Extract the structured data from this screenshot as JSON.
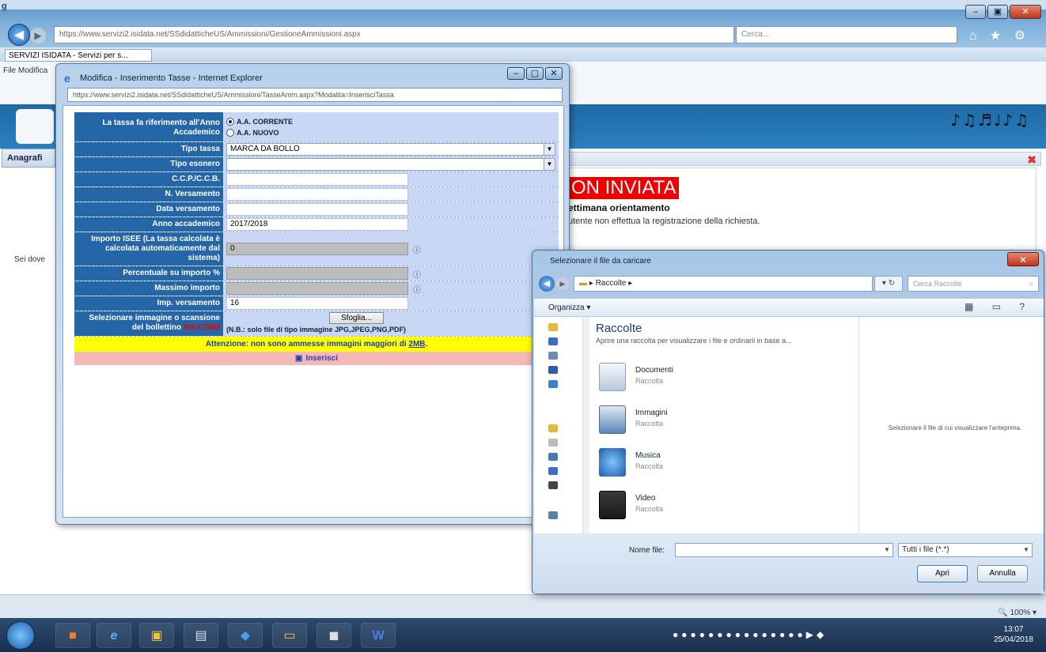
{
  "browser": {
    "top_strip_text": "g",
    "address": "https://www.servizi2.isidata.net/SSdidatticheUS/Ammissioni/GestioneAmmissioni.aspx",
    "search_placeholder": "Cerca...",
    "tab_label": "SERVIZI ISIDATA - Servizi per s...",
    "menu_text": "File  Modifica",
    "window_buttons": [
      "–",
      "▣",
      "✕"
    ],
    "toolbar_icons": "⌂ ★ ⚙"
  },
  "page": {
    "logo_right_text": "♪♫♬♩♪♫",
    "side_tab": "Anagrafi",
    "side_label": "Sei dove",
    "not_sent_banner": "ON INVIATA",
    "week_title": "ettimana orientamento",
    "week_text": "utente non effettua la registrazione della richiesta.",
    "zoom": "100%"
  },
  "popup": {
    "title": "Modifica - Inserimento Tasse - Internet Explorer",
    "address": "https://www.servizi2.isidata.net/SSdidatticheUS/Ammissioni/TasseAmm.aspx?Modalita=InserisciTassa",
    "form": {
      "row_anno": {
        "label": "La tassa fa riferimento all'Anno Accademico",
        "opt1": "A.A. CORRENTE",
        "opt2": "A.A. NUOVO"
      },
      "row_tipo_tassa": {
        "label": "Tipo tassa",
        "value": "MARCA DA BOLLO"
      },
      "row_tipo_esonero": {
        "label": "Tipo esonero",
        "value": ""
      },
      "row_ccp": {
        "label": "C.C.P./C.C.B.",
        "value": ""
      },
      "row_versamento": {
        "label": "N. Versamento",
        "value": ""
      },
      "row_data": {
        "label": "Data versamento",
        "value": ""
      },
      "row_anno_acc": {
        "label": "Anno accademico",
        "value": "2017/2018"
      },
      "row_importo": {
        "label": "Importo ISEE (La tassa calcolata è calcolata automaticamente dal sistema)",
        "value": "0"
      },
      "row_percentuale": {
        "label": "Percentuale su importo %",
        "value": ""
      },
      "row_massimo": {
        "label": "Massimo importo",
        "value": ""
      },
      "row_imp_versamento": {
        "label": "Imp. versamento",
        "value": "16"
      },
      "row_file": {
        "label": "Selezionare immagine o scansione del bollettino",
        "max": "MAX 2MB",
        "button": "Sfoglia...",
        "note": "(N.B.: solo file di tipo immagine JPG,JPEG,PNG,PDF)"
      },
      "warning": "Attenzione: non sono ammesse immagini maggiori di ",
      "warning_link": "2MB",
      "submit": "Inserisci"
    }
  },
  "file_dialog": {
    "title": "Selezionare il file da caricare",
    "path": "▸ Raccolte ▸",
    "search_placeholder": "Cerca Raccolte",
    "organize": "Organizza ▾",
    "library_title": "Raccolte",
    "library_subtitle": "Aprire una raccolta per visualizzare i file e ordinarli in base a...",
    "items": [
      {
        "name": "Documenti",
        "kind": "Raccolta"
      },
      {
        "name": "Immagini",
        "kind": "Raccolta"
      },
      {
        "name": "Musica",
        "kind": "Raccolta"
      },
      {
        "name": "Video",
        "kind": "Raccolta"
      }
    ],
    "preview_text": "Selezionare il file di cui visualizzare l'anteprima.",
    "name_label": "Nome file:",
    "type_value": "Tutti i file (*.*)",
    "open_button": "Apri",
    "cancel_button": "Annulla"
  },
  "taskbar": {
    "clock_time": "13:07",
    "clock_date": "25/04/2018"
  }
}
